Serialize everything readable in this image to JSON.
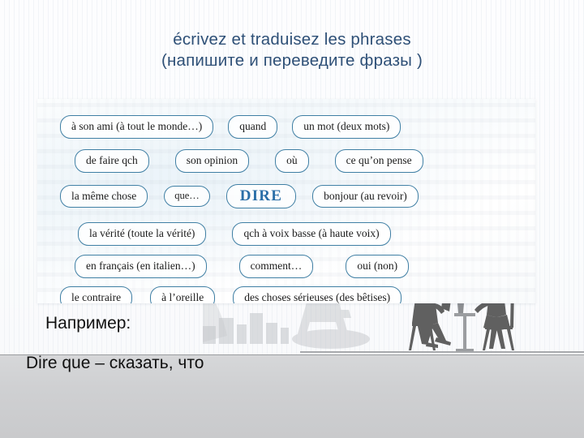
{
  "slide": {
    "title": {
      "line1": "écrivez et traduisez les phrases",
      "line2": "(напишите и переведите фразы )",
      "color": "#2e5077"
    },
    "panel": {
      "accent_color": "#3f7fa4",
      "center_word": "DIRE",
      "rows": [
        {
          "row_index": 1,
          "items": [
            {
              "text": "à son ami (à tout le monde…)"
            },
            {
              "text": "quand"
            },
            {
              "text": "un mot (deux mots)"
            }
          ]
        },
        {
          "row_index": 2,
          "items": [
            {
              "text": "de faire qch"
            },
            {
              "text": "son opinion"
            },
            {
              "text": "où"
            },
            {
              "text": "ce qu’on pense"
            }
          ]
        },
        {
          "row_index": 3,
          "items": [
            {
              "text": "la même chose"
            },
            {
              "text": "que…"
            },
            {
              "text": "DIRE"
            },
            {
              "text": "bonjour (au revoir)"
            }
          ]
        },
        {
          "row_index": 4,
          "items": [
            {
              "text": "la vérité (toute la vérité)"
            },
            {
              "text": "qch à voix basse (à haute voix)"
            }
          ]
        },
        {
          "row_index": 5,
          "items": [
            {
              "text": "en français (en italien…)"
            },
            {
              "text": "comment…"
            },
            {
              "text": "oui (non)"
            }
          ]
        },
        {
          "row_index": 6,
          "items": [
            {
              "text": "le contraire"
            },
            {
              "text": "à l’oreille"
            },
            {
              "text": "des choses sérieuses (des bêtises)"
            }
          ]
        }
      ]
    },
    "example": {
      "label": "Например:",
      "sentence": "Dire que – сказать, что"
    },
    "decoration": {
      "eiffel_tower": "eiffel-tower-silhouette",
      "skyline": "city-skyline-silhouette",
      "cafe_figures": "cafe-couple-silhouette",
      "silhouette_color": "#606060"
    }
  }
}
